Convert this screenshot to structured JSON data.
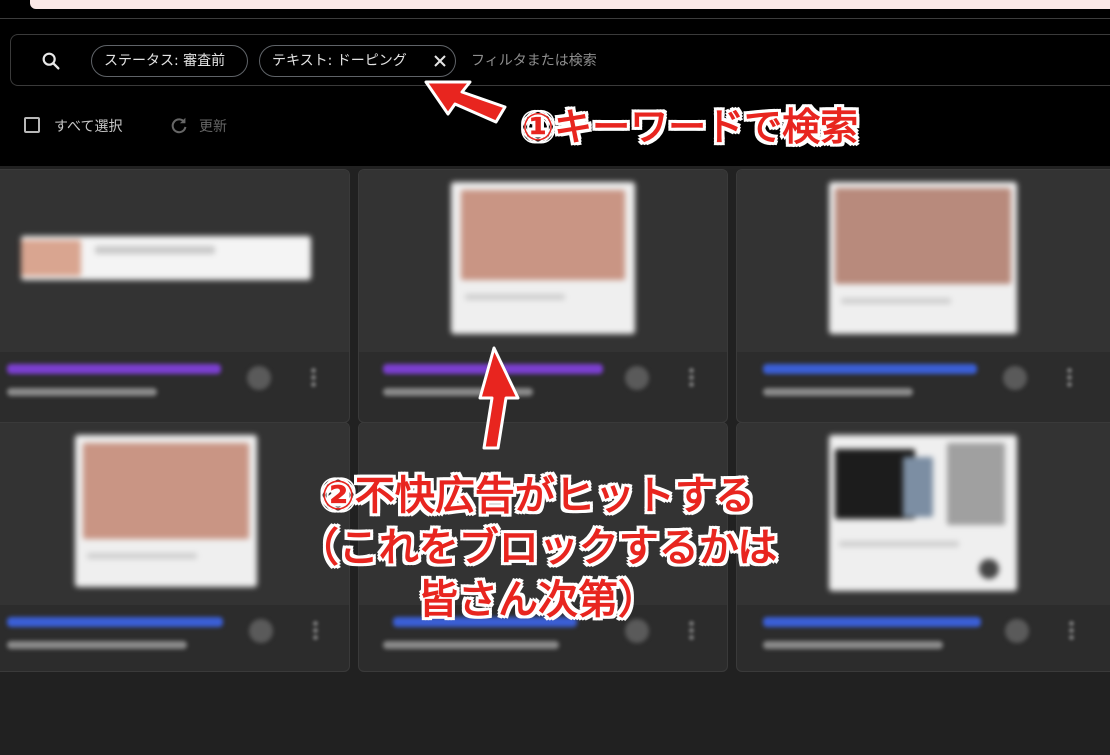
{
  "filter_bar": {
    "chips": [
      {
        "label": "ステータス: 審査前"
      },
      {
        "label": "テキスト: ドーピング"
      }
    ],
    "placeholder": "フィルタまたは検索",
    "select_all_label": "すべて選択",
    "refresh_label": "更新"
  },
  "annotations": {
    "step1": "①キーワードで検索",
    "step2_line1": "②不快広告がヒットする",
    "step2_line2": "（これをブロックするかは",
    "step2_line3": "皆さん次第）"
  },
  "colors": {
    "annotation_red": "#e8251f",
    "title_purple": "#7b3fd0",
    "title_blue": "#3b5fd6"
  },
  "icons": [
    "search-icon",
    "close-icon",
    "refresh-icon",
    "more-vert-icon"
  ]
}
